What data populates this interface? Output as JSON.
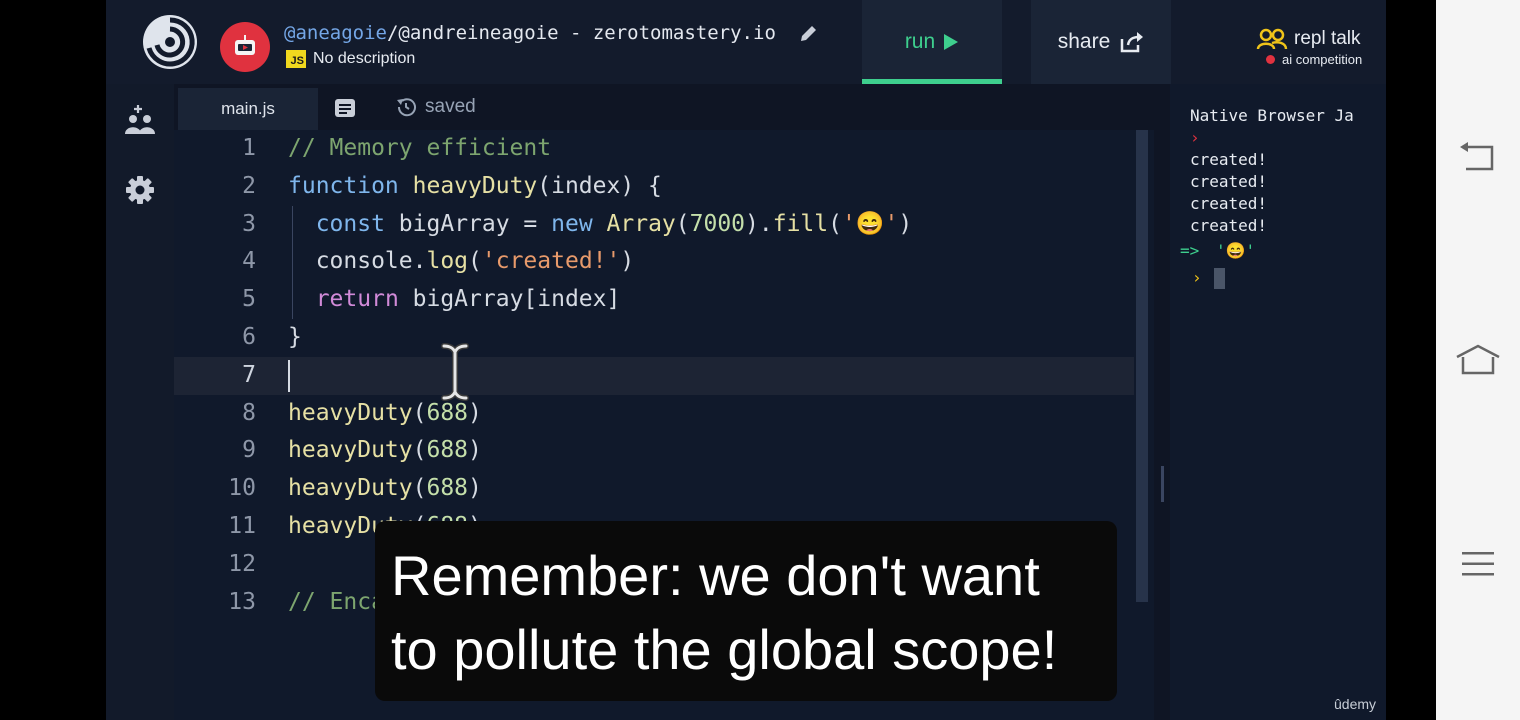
{
  "header": {
    "repl_user": "@aneagoie",
    "repl_name": "/@andreineagoie - zerotomastery.io",
    "language_badge": "JS",
    "description": "No description",
    "run_label": "run",
    "share_label": "share",
    "talk_title": "repl talk",
    "talk_subtitle": "ai competition"
  },
  "editor": {
    "tab": "main.js",
    "status": "saved",
    "current_line": 7,
    "lines": [
      {
        "n": "1",
        "tokens": [
          {
            "t": "// Memory efficient",
            "c": "com"
          }
        ]
      },
      {
        "n": "2",
        "tokens": [
          {
            "t": "function",
            "c": "kw"
          },
          {
            "t": " ",
            "c": "plain"
          },
          {
            "t": "heavyDuty",
            "c": "fn"
          },
          {
            "t": "(index) {",
            "c": "plain"
          }
        ]
      },
      {
        "n": "3",
        "tokens": [
          {
            "t": "  ",
            "c": "plain"
          },
          {
            "t": "const",
            "c": "kw"
          },
          {
            "t": " bigArray = ",
            "c": "plain"
          },
          {
            "t": "new",
            "c": "kw"
          },
          {
            "t": " ",
            "c": "plain"
          },
          {
            "t": "Array",
            "c": "fn"
          },
          {
            "t": "(",
            "c": "plain"
          },
          {
            "t": "7000",
            "c": "num"
          },
          {
            "t": ").",
            "c": "plain"
          },
          {
            "t": "fill",
            "c": "fn"
          },
          {
            "t": "(",
            "c": "plain"
          },
          {
            "t": "'😄'",
            "c": "str"
          },
          {
            "t": ")",
            "c": "plain"
          }
        ]
      },
      {
        "n": "4",
        "tokens": [
          {
            "t": "  console.",
            "c": "plain"
          },
          {
            "t": "log",
            "c": "fn"
          },
          {
            "t": "(",
            "c": "plain"
          },
          {
            "t": "'created!'",
            "c": "str"
          },
          {
            "t": ")",
            "c": "plain"
          }
        ]
      },
      {
        "n": "5",
        "tokens": [
          {
            "t": "  ",
            "c": "plain"
          },
          {
            "t": "return",
            "c": "ret"
          },
          {
            "t": " bigArray[index]",
            "c": "plain"
          }
        ]
      },
      {
        "n": "6",
        "tokens": [
          {
            "t": "}",
            "c": "plain"
          }
        ]
      },
      {
        "n": "7",
        "tokens": []
      },
      {
        "n": "8",
        "tokens": [
          {
            "t": "heavyDuty",
            "c": "fn"
          },
          {
            "t": "(",
            "c": "plain"
          },
          {
            "t": "688",
            "c": "num"
          },
          {
            "t": ")",
            "c": "plain"
          }
        ]
      },
      {
        "n": "9",
        "tokens": [
          {
            "t": "heavyDuty",
            "c": "fn"
          },
          {
            "t": "(",
            "c": "plain"
          },
          {
            "t": "688",
            "c": "num"
          },
          {
            "t": ")",
            "c": "plain"
          }
        ]
      },
      {
        "n": "10",
        "tokens": [
          {
            "t": "heavyDuty",
            "c": "fn"
          },
          {
            "t": "(",
            "c": "plain"
          },
          {
            "t": "688",
            "c": "num"
          },
          {
            "t": ")",
            "c": "plain"
          }
        ]
      },
      {
        "n": "11",
        "tokens": [
          {
            "t": "heavyDuty",
            "c": "fn"
          },
          {
            "t": "(",
            "c": "plain"
          },
          {
            "t": "688",
            "c": "num"
          },
          {
            "t": ")",
            "c": "plain"
          }
        ]
      },
      {
        "n": "12",
        "tokens": []
      },
      {
        "n": "13",
        "tokens": [
          {
            "t": "// Encapsulation",
            "c": "com"
          }
        ]
      }
    ]
  },
  "console": {
    "title": "Native Browser Ja",
    "output": [
      "created!",
      "created!",
      "created!",
      "created!"
    ],
    "arrow": "=>",
    "result": "'😄'"
  },
  "subtitle": {
    "line1": "Remember: we don't want",
    "line2": "to pollute the global scope!"
  },
  "watermark": "ûdemy",
  "colors": {
    "accent_green": "#3ecf8e",
    "avatar_red": "#e0323f",
    "js_yellow": "#f0d81e"
  }
}
